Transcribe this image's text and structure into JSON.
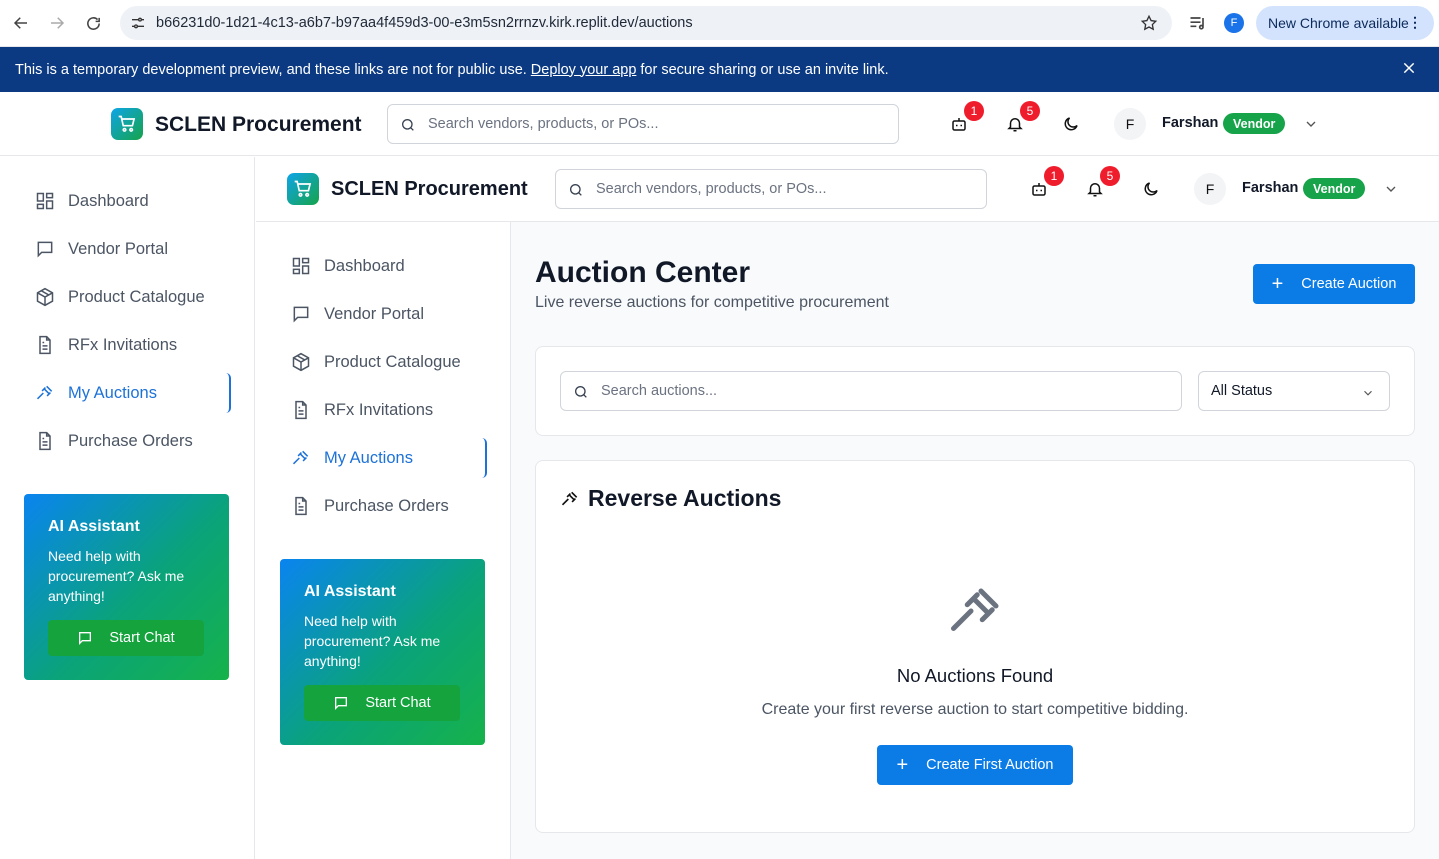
{
  "browser": {
    "url": "b66231d0-1d21-4c13-a6b7-b97aa4f459d3-00-e3m5sn2rrnzv.kirk.replit.dev/auctions",
    "profile_initial": "F",
    "update_label": "New Chrome available"
  },
  "dev_banner": {
    "text_before": "This is a temporary development preview, and these links are not for public use.",
    "link": "Deploy your app",
    "text_after": "for secure sharing or use an invite link."
  },
  "header": {
    "brand": "SCLEN Procurement",
    "search_placeholder": "Search vendors, products, or POs...",
    "cart_badge": "1",
    "notif_badge": "5",
    "user_initial": "F",
    "user_name": "Farshan",
    "user_role": "Vendor"
  },
  "sidebar": {
    "items": [
      {
        "label": "Dashboard",
        "icon": "dashboard-icon"
      },
      {
        "label": "Vendor Portal",
        "icon": "message-square-icon"
      },
      {
        "label": "Product Catalogue",
        "icon": "package-icon"
      },
      {
        "label": "RFx Invitations",
        "icon": "file-text-icon"
      },
      {
        "label": "My Auctions",
        "icon": "gavel-icon",
        "active": true
      },
      {
        "label": "Purchase Orders",
        "icon": "file-text-icon"
      }
    ],
    "ai": {
      "title": "AI Assistant",
      "desc": "Need help with procurement? Ask me anything!",
      "button": "Start Chat"
    }
  },
  "main": {
    "title": "Auction Center",
    "subtitle": "Live reverse auctions for competitive procurement",
    "create_button": "Create Auction",
    "search_placeholder": "Search auctions...",
    "status_filter": "All Status",
    "section_title": "Reverse Auctions",
    "empty_title": "No Auctions Found",
    "empty_desc": "Create your first reverse auction to start competitive bidding.",
    "empty_button": "Create First Auction"
  },
  "colors": {
    "primary": "#0b7be6",
    "active_nav": "#1d72d8",
    "vendor_badge": "#16a34a",
    "dev_banner": "#0b3a82",
    "badge_red": "#ef1c2b"
  }
}
